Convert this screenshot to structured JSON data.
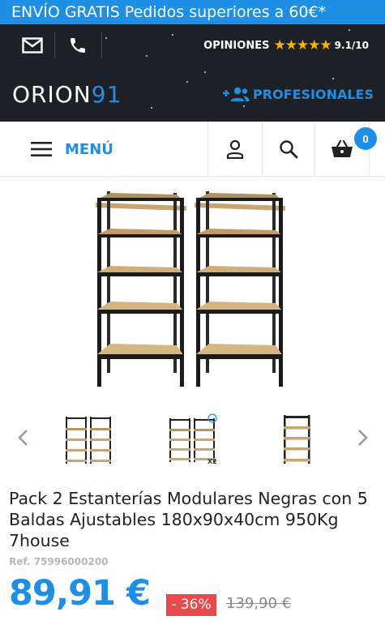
{
  "promo": {
    "text": "ENVÍO GRATIS Pedidos superiores a 60€*"
  },
  "topbar": {
    "mail_icon": "mail-icon",
    "phone_icon": "phone-icon",
    "reviews_label": "OPINIONES",
    "stars": "★★★★★",
    "rating": 4.55,
    "score": "9.1/10"
  },
  "brand": {
    "logo_part1": "ORION",
    "logo_part2": "91",
    "professionals_label": "PROFESIONALES",
    "professionals_icon": "add-user-icon"
  },
  "nav": {
    "menu_label": "MENÚ",
    "menu_icon": "hamburger-icon",
    "user_icon": "user-icon",
    "search_icon": "search-icon",
    "cart_icon": "cart-icon",
    "cart_count": "0"
  },
  "product": {
    "title": "Pack 2 Estanterías Modulares Negras con 5 Baldas Ajustables 180x90x40cm 950Kg 7house",
    "ref": "Ref. 75996000200",
    "price": "89,91 €",
    "discount": "- 36%",
    "old_price": "139,90 €"
  },
  "gallery": {
    "prev_icon": "chevron-left-icon",
    "next_icon": "chevron-right-icon",
    "thumb2_badge": "X2"
  },
  "colors": {
    "accent": "#1f8fe6",
    "dark": "#1d2126",
    "sale": "#e84b4b",
    "star": "#f4b400"
  }
}
